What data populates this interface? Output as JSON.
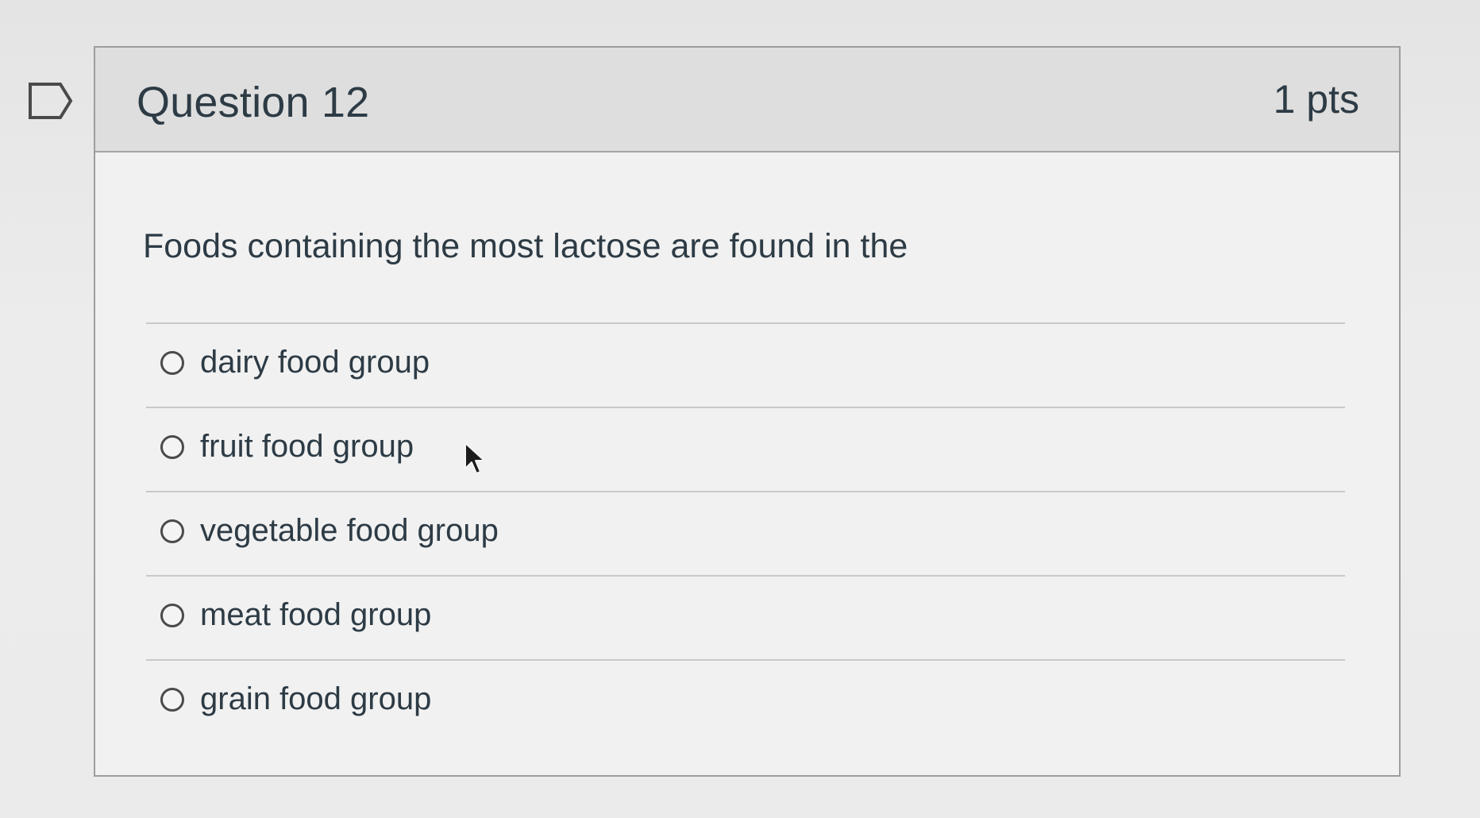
{
  "question": {
    "title": "Question 12",
    "points": "1 pts",
    "text": "Foods containing the most lactose are found in the",
    "flag_icon": "flag-outline-icon",
    "answers": [
      {
        "label": "dairy food group"
      },
      {
        "label": "fruit food group"
      },
      {
        "label": "vegetable food group"
      },
      {
        "label": "meat food group"
      },
      {
        "label": "grain food group"
      }
    ]
  },
  "colors": {
    "text": "#2d3b45",
    "header_bg": "#dedede",
    "card_bg": "#f1f1f1",
    "border": "#9d9d9d"
  }
}
